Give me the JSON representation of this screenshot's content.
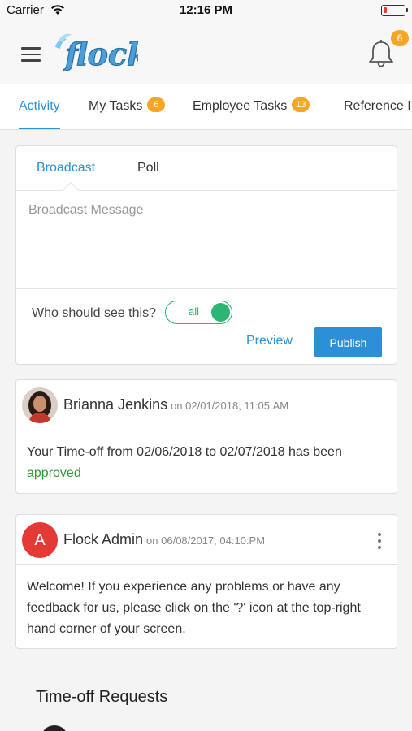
{
  "status_bar": {
    "carrier": "Carrier",
    "time": "12:16 PM"
  },
  "header": {
    "logo_text": "flock",
    "notification_count": "6"
  },
  "tabs": [
    {
      "label": "Activity",
      "active": true
    },
    {
      "label": "My Tasks",
      "badge": "6"
    },
    {
      "label": "Employee Tasks",
      "badge": "13"
    },
    {
      "label": "Reference I"
    }
  ],
  "composer": {
    "tabs": [
      "Broadcast",
      "Poll"
    ],
    "placeholder": "Broadcast Message",
    "visibility_label": "Who should see this?",
    "visibility_value": "all",
    "preview_label": "Preview",
    "publish_label": "Publish"
  },
  "posts": [
    {
      "author": "Brianna Jenkins",
      "date": "on 02/01/2018, 11:05:AM",
      "message": "Your Time-off from 02/06/2018 to 02/07/2018 has been",
      "status": "approved"
    },
    {
      "avatar_letter": "A",
      "author": "Flock Admin",
      "date": "on 06/08/2017, 04:10:PM",
      "message": "Welcome! If you experience any problems or have any feedback for us, please click on the '?' icon at the top-right hand corner of your screen."
    }
  ],
  "section_title": "Time-off Requests",
  "colors": {
    "accent": "#2d8fd5",
    "badge": "#f5a623",
    "toggle": "#2bb673",
    "approved": "#2e9b35",
    "admin_avatar": "#e53935"
  }
}
